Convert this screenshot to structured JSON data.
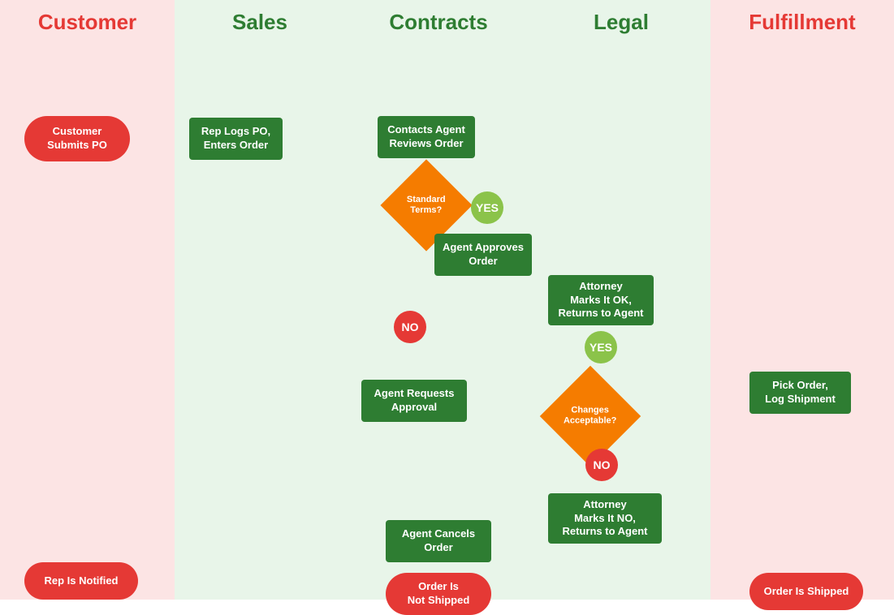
{
  "lanes": [
    {
      "id": "customer",
      "label": "Customer",
      "type": "customer"
    },
    {
      "id": "sales",
      "label": "Sales",
      "type": "sales"
    },
    {
      "id": "contracts",
      "label": "Contracts",
      "type": "contracts"
    },
    {
      "id": "legal",
      "label": "Legal",
      "type": "legal"
    },
    {
      "id": "fulfillment",
      "label": "Fulfillment",
      "type": "fulfillment"
    }
  ],
  "nodes": {
    "customer_submits_po": "Customer Submits PO",
    "rep_logs_po": "Rep Logs PO,\nEnters Order",
    "contacts_agent": "Contacts Agent\nReviews Order",
    "standard_terms": "Standard\nTerms?",
    "yes1": "YES",
    "agent_approves": "Agent Approves\nOrder",
    "no1": "NO",
    "agent_requests": "Agent Requests\nApproval",
    "changes_acceptable": "Changes\nAcceptable?",
    "yes2": "YES",
    "no2": "NO",
    "attorney_ok": "Attorney\nMarks It OK,\nReturns to Agent",
    "attorney_no": "Attorney\nMarks It NO,\nReturns to Agent",
    "agent_cancels": "Agent Cancels\nOrder",
    "pick_order": "Pick Order,\nLog Shipment",
    "rep_is_notified": "Rep Is Notified",
    "order_not_shipped": "Order Is\nNot Shipped",
    "order_shipped": "Order Is Shipped"
  }
}
